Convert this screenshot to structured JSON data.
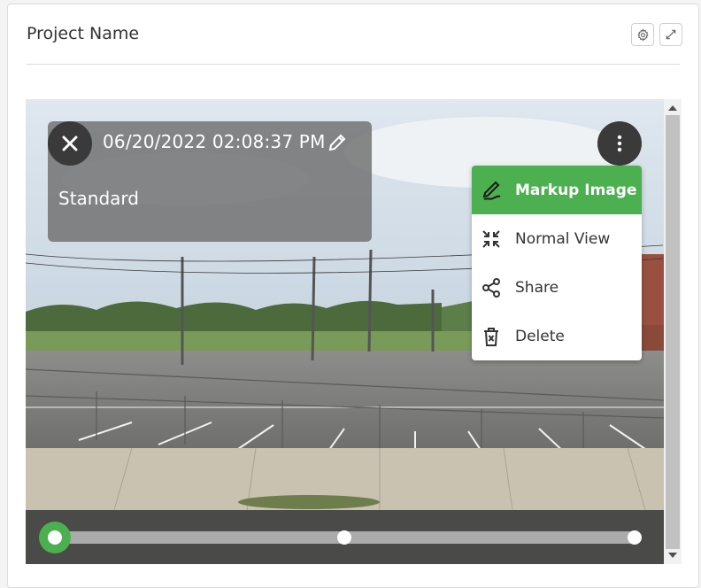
{
  "card": {
    "title": "Project Name",
    "settings_icon": "gear-icon",
    "expand_icon": "expand-icon"
  },
  "viewer": {
    "timestamp": "06/20/2022 02:08:37 PM",
    "category": "Standard",
    "close_icon": "close-icon",
    "edit_icon": "pencil-icon",
    "more_icon": "more-vertical-icon",
    "menu": [
      {
        "label": "Markup Image",
        "icon": "markup-icon",
        "active": true
      },
      {
        "label": "Normal View",
        "icon": "compress-icon",
        "active": false
      },
      {
        "label": "Share",
        "icon": "share-icon",
        "active": false
      },
      {
        "label": "Delete",
        "icon": "trash-icon",
        "active": false
      }
    ],
    "timeline": {
      "points": 3,
      "current_index": 0
    }
  },
  "colors": {
    "accent": "#4caf50",
    "overlay": "#3a3a3a"
  }
}
